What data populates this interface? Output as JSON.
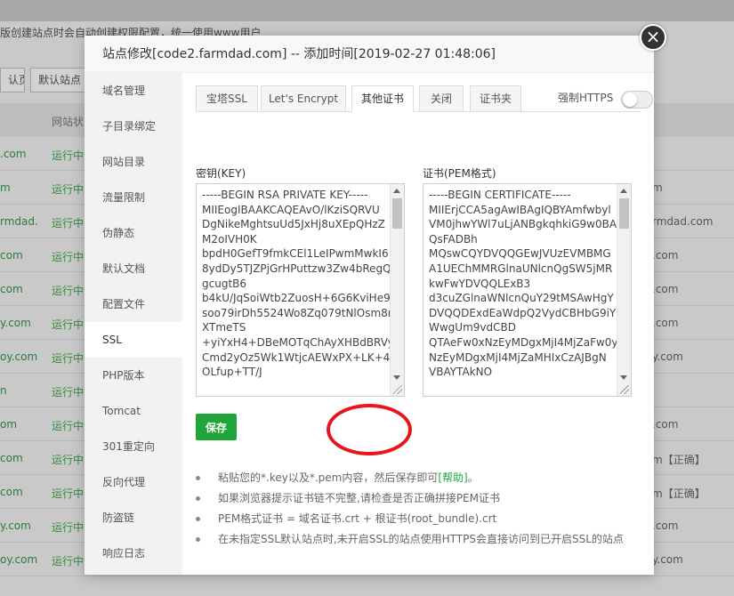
{
  "background": {
    "notice": "版创建站点时会自动创建权限配置，统一使用www用户",
    "buttons": [
      "认页",
      "默认站点"
    ],
    "column_header": "网站状",
    "rows": [
      {
        "site": ".com",
        "status": "运行中",
        "right": ""
      },
      {
        "site": "m",
        "status": "运行中",
        "right": "m"
      },
      {
        "site": "rmdad.",
        "status": "运行中",
        "right": "rmdad.com"
      },
      {
        "site": "com",
        "status": "运行中",
        "right": ".com"
      },
      {
        "site": "com",
        "status": "运行中",
        "right": ".com"
      },
      {
        "site": "y.com",
        "status": "运行中",
        "right": ".com"
      },
      {
        "site": "oy.com",
        "status": "运行中",
        "right": "y.com"
      },
      {
        "site": "n",
        "status": "运行中",
        "right": ""
      },
      {
        "site": "om",
        "status": "运行中",
        "right": ".com"
      },
      {
        "site": "com",
        "status": "运行中",
        "right": "m【正确】"
      },
      {
        "site": "com",
        "status": "运行中",
        "right": "m【正确】"
      },
      {
        "site": "y.com",
        "status": "运行中",
        "right": ".com"
      },
      {
        "site": "oy.com",
        "status": "运行中",
        "right": "y.com"
      }
    ]
  },
  "modal": {
    "title": "站点修改[code2.farmdad.com] -- 添加时间[2019-02-27 01:48:06]",
    "close_icon": "×",
    "nav": [
      "域名管理",
      "子目录绑定",
      "网站目录",
      "流量限制",
      "伪静态",
      "默认文档",
      "配置文件",
      "SSL",
      "PHP版本",
      "Tomcat",
      "301重定向",
      "反向代理",
      "防盗链",
      "响应日志"
    ],
    "active_nav": "SSL",
    "tabs": [
      "宝塔SSL",
      "Let's Encrypt",
      "其他证书",
      "关闭",
      "证书夹"
    ],
    "active_tab": "其他证书",
    "force_https_label": "强制HTTPS",
    "force_https_on": false,
    "key_label": "密钥(KEY)",
    "cert_label": "证书(PEM格式)",
    "key_value": "-----BEGIN RSA PRIVATE KEY-----\nMIIEogIBAAKCAQEAvO/lKziSQRVU\nDgNikeMghtsuUd5JxHj8uXEpQHzZ\nM2oIVH0K\nbpdH0GefT9fmkCEl1LeIPwmMwkI6\n8ydDy5TJZPjGrHPuttzw3Zw4bRegQ\ngcugtB6\nb4kU/JqSoiWtb2ZuosH+6G6KviHe9\nsoo79irDh5524Wo8Zq079tNlOsm8n\nXTmeTS\n+yiYxH4+DBeMOTqChAyXHBdBRVy\nCmd2yOz5Wk1WtjcAEWxPX+LK+44\nOLfup+TT/J",
    "cert_value": "-----BEGIN CERTIFICATE-----\nMIIErjCCA5agAwIBAgIQBYAmfwbyl\nVM0jhwYWl7uLjANBgkqhkiG9w0BA\nQsFADBh\nMQswCQYDVQQGEwJVUzEVMBMG\nA1UEChMMRGlnaUNlcnQgSW5jMR\nkwFwYDVQQLExB3\nd3cuZGlnaWNlcnQuY29tMSAwHgY\nDVQQDExdEaWdpQ2VydCBHbG9iY\nWwgUm9vdCBD\nQTAeFw0xNzEyMDgxMjI4MjZaFw0y\nNzEyMDgxMjI4MjZaMHIxCzAJBgN\nVBAYTAkNO",
    "save_label": "保存",
    "tips": [
      {
        "text": "粘贴您的*.key以及*.pem内容，然后保存即可",
        "link": "[帮助]",
        "suffix": "。"
      },
      {
        "text": "如果浏览器提示证书链不完整,请检查是否正确拼接PEM证书",
        "link": "",
        "suffix": ""
      },
      {
        "text": "PEM格式证书 = 域名证书.crt + 根证书(root_bundle).crt",
        "link": "",
        "suffix": ""
      },
      {
        "text": "在未指定SSL默认站点时,未开启SSL的站点使用HTTPS会直接访问到已开启SSL的站点",
        "link": "",
        "suffix": ""
      }
    ]
  },
  "colors": {
    "accent_green": "#20a53a",
    "annotation_red": "#e8151b"
  }
}
